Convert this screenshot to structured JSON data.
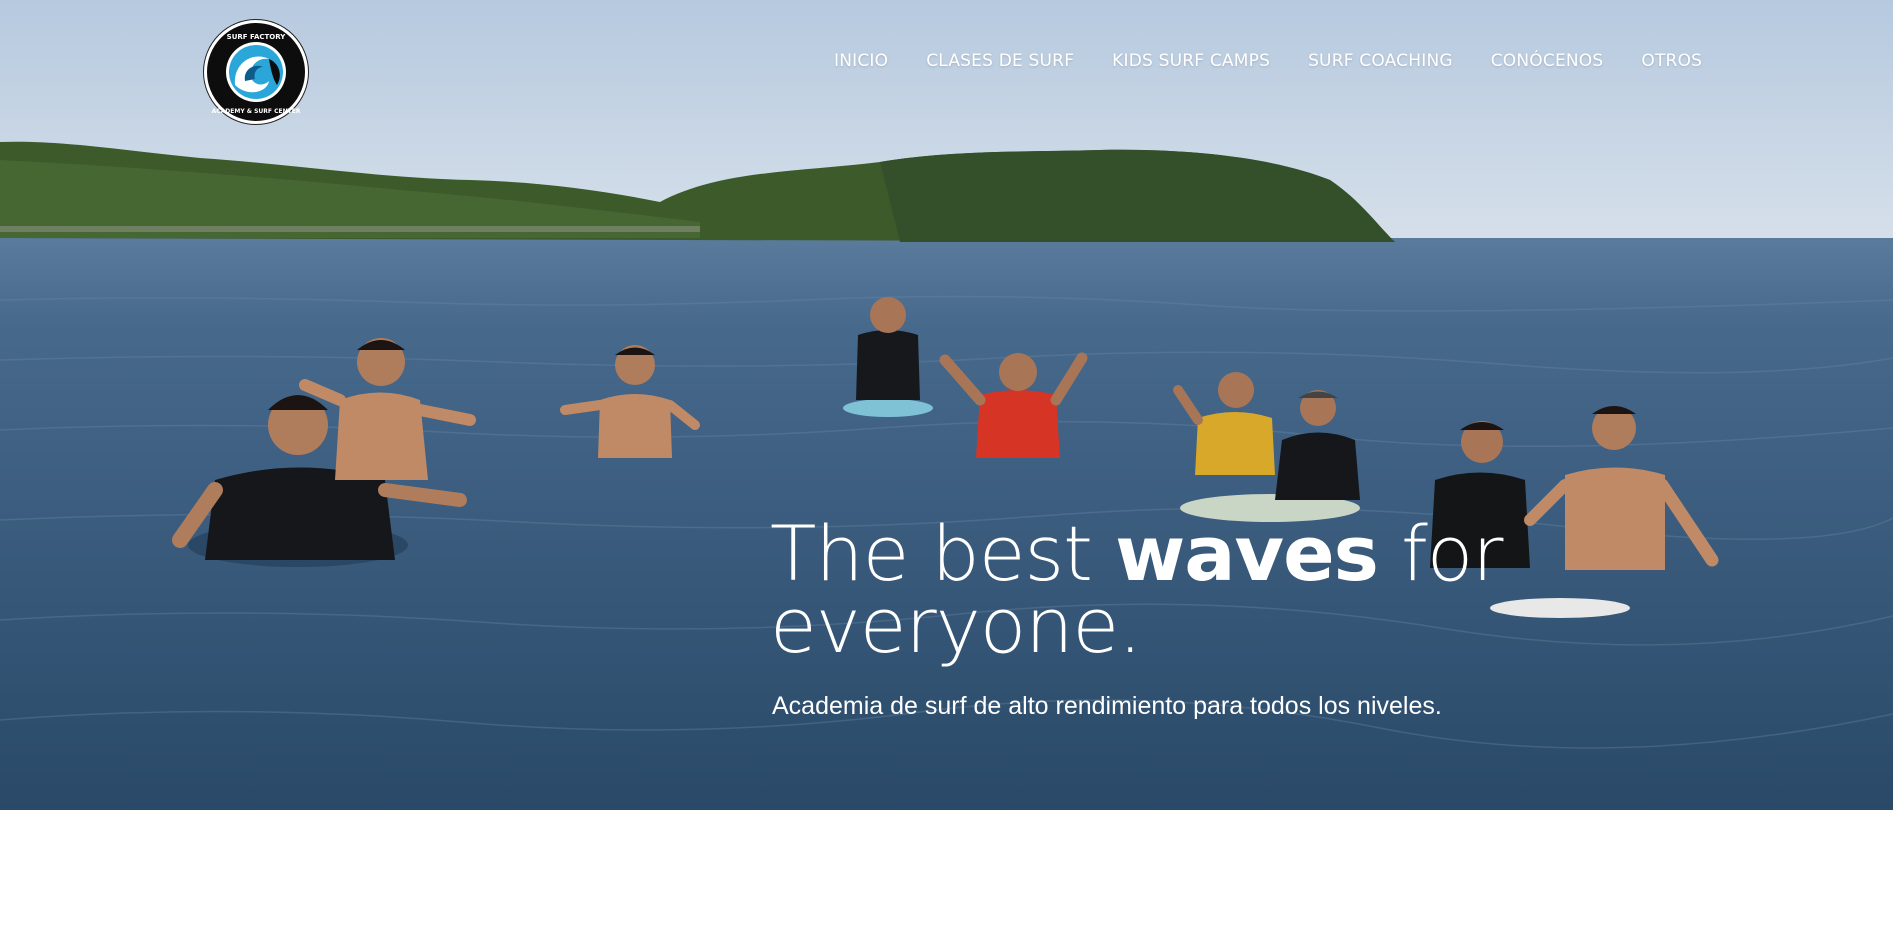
{
  "logo": {
    "ring_text_top": "SURF FACTORY",
    "ring_text_bottom": "ACADEMY & SURF CENTER",
    "icon": "wave-icon"
  },
  "nav": {
    "items": [
      {
        "label": "INICIO"
      },
      {
        "label": "CLASES DE SURF"
      },
      {
        "label": "KIDS SURF CAMPS"
      },
      {
        "label": "SURF COACHING"
      },
      {
        "label": "CONÓCENOS"
      },
      {
        "label": "OTROS"
      }
    ]
  },
  "hero": {
    "headline_part1": "The best ",
    "headline_bold": "waves",
    "headline_part2": " for",
    "headline_line2": "everyone.",
    "subtitle": "Academia de surf de alto rendimiento para todos los niveles."
  },
  "colors": {
    "sky": "#c8d6e6",
    "water": "#3a5b7d",
    "hills": "#3e5a2c",
    "text": "#ffffff"
  }
}
